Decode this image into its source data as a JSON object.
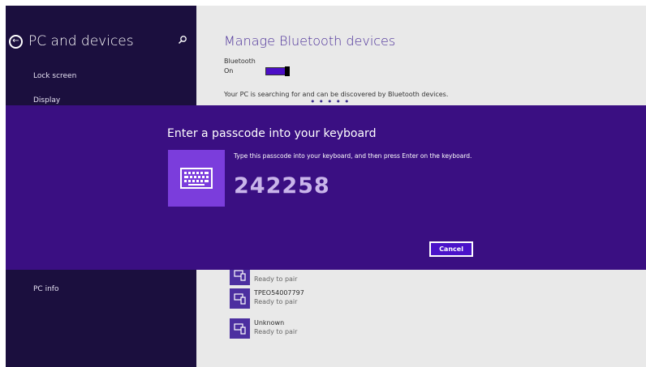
{
  "sidebar": {
    "title": "PC and devices",
    "items": [
      {
        "label": "Lock screen"
      },
      {
        "label": "Display"
      },
      {
        "label": "PC info"
      }
    ]
  },
  "main": {
    "title": "Manage Bluetooth devices",
    "bluetooth": {
      "label": "Bluetooth",
      "state": "On",
      "toggle_on": true
    },
    "status_text": "Your PC is searching for and can be discovered by Bluetooth devices.",
    "devices": [
      {
        "name": "",
        "status": "Ready to pair"
      },
      {
        "name": "TPEO54007797",
        "status": "Ready to pair"
      },
      {
        "name": "Unknown",
        "status": "Ready to pair"
      }
    ]
  },
  "dialog": {
    "title": "Enter a passcode into your keyboard",
    "instruction": "Type this passcode into your keyboard, and then press Enter on the keyboard.",
    "passcode": "242258",
    "cancel_label": "Cancel"
  },
  "icons": {
    "back": "back-arrow-icon",
    "search": "search-icon",
    "keyboard": "keyboard-icon",
    "device": "device-icon"
  },
  "colors": {
    "sidebar_bg": "#1b0f3e",
    "dialog_bg": "#3a0f82",
    "accent": "#4b0ec6",
    "tile": "#7b3ddc"
  }
}
